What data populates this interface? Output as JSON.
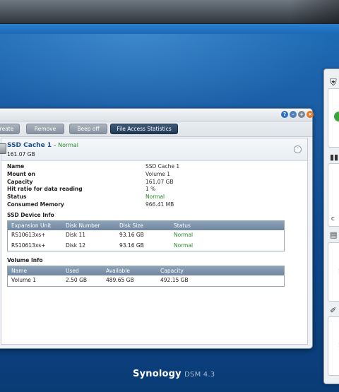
{
  "toolbar": {
    "create_label": "reate",
    "remove_label": "Remove",
    "beep_off_label": "Beep off",
    "file_access_label": "File Access Statistics"
  },
  "cache": {
    "title": "SSD Cache 1",
    "separator": " - ",
    "status": "Normal",
    "size": "161.07 GB"
  },
  "properties": [
    {
      "key": "Name",
      "value": "SSD Cache 1"
    },
    {
      "key": "Mount on",
      "value": "Volume 1"
    },
    {
      "key": "Capacity",
      "value": "161.07 GB"
    },
    {
      "key": "Hit ratio for data reading",
      "value": "1 %"
    },
    {
      "key": "Status",
      "value": "Normal"
    },
    {
      "key": "Consumed Memory",
      "value": "966.41 MB"
    }
  ],
  "ssd_device_info": {
    "title": "SSD Device Info",
    "columns": [
      "Expansion Unit",
      "Disk Number",
      "Disk Size",
      "Status"
    ],
    "rows": [
      [
        "RS10613xs+",
        "Disk 11",
        "93.16 GB",
        "Normal"
      ],
      [
        "RS10613xs+",
        "Disk 12",
        "93.16 GB",
        "Normal"
      ]
    ]
  },
  "volume_info": {
    "title": "Volume Info",
    "columns": [
      "Name",
      "Used",
      "Available",
      "Capacity"
    ],
    "rows": [
      [
        "Volume 1",
        "2.50 GB",
        "489.65 GB",
        "492.15 GB"
      ]
    ]
  },
  "brand": {
    "logo": "Synology",
    "version": "DSM 4.3"
  },
  "widgets": {
    "partial_text": [
      "C",
      "1",
      "1"
    ]
  },
  "colors": {
    "accent": "#1c4e8c",
    "status_normal": "#2a8a2a",
    "grid_header": "#7f94ac",
    "desktop": "#1a5ea6"
  }
}
